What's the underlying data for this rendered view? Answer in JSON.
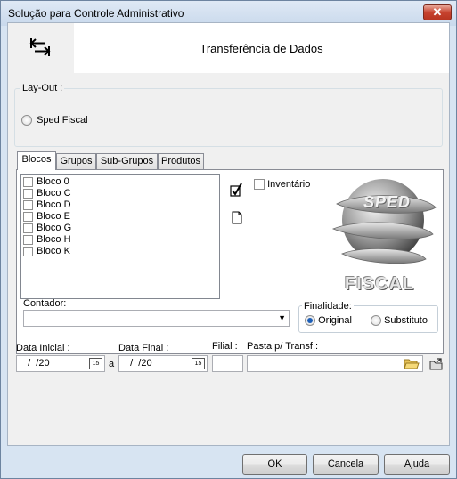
{
  "window": {
    "title": "Solução para Controle Administrativo",
    "close_glyph": "✕"
  },
  "header": {
    "title": "Transferência de Dados",
    "icon": "transfer-arrows-icon"
  },
  "layout_group": {
    "label": "Lay-Out :",
    "option": "Sped Fiscal",
    "selected": false
  },
  "tabs": [
    {
      "label": "Blocos",
      "active": true
    },
    {
      "label": "Grupos",
      "active": false
    },
    {
      "label": "Sub-Grupos",
      "active": false
    },
    {
      "label": "Produtos",
      "active": false
    }
  ],
  "blocks": [
    {
      "label": "Bloco 0",
      "checked": false
    },
    {
      "label": "Bloco C",
      "checked": false
    },
    {
      "label": "Bloco D",
      "checked": false
    },
    {
      "label": "Bloco E",
      "checked": false
    },
    {
      "label": "Bloco G",
      "checked": false
    },
    {
      "label": "Bloco H",
      "checked": false
    },
    {
      "label": "Bloco K",
      "checked": false
    }
  ],
  "tools": {
    "check_all_icon": "checkmark-icon",
    "blank_icon": "document-icon"
  },
  "inventario": {
    "label": "Inventário",
    "checked": false
  },
  "logo": {
    "top_text": "SPED",
    "bottom_text": "FISCAL"
  },
  "contador": {
    "label": "Contador:",
    "value": ""
  },
  "finalidade": {
    "label": "Finalidade:",
    "options": [
      "Original",
      "Substituto"
    ],
    "selected": "Original"
  },
  "data_inicial": {
    "label": "Data Inicial :",
    "value": "  /  /20",
    "cal": "15"
  },
  "separator": "a",
  "data_final": {
    "label": "Data Final :",
    "value": "  /  /20",
    "cal": "15"
  },
  "filial": {
    "label": "Filial :",
    "value": ""
  },
  "pasta": {
    "label": "Pasta p/ Transf.:",
    "value": ""
  },
  "buttons": {
    "ok": "OK",
    "cancel": "Cancela",
    "help": "Ajuda"
  }
}
